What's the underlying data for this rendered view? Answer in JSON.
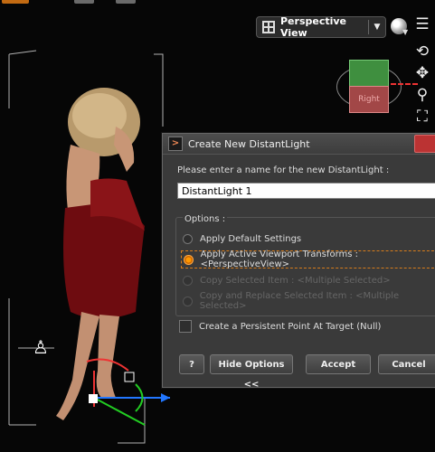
{
  "viewport": {
    "view_selector": {
      "label": "Perspective View",
      "icon": "grid-view-icon",
      "dropdown_icon": "triangle-down-icon"
    },
    "nav_cube": {
      "face_label": "Right",
      "top_color": "#3f8f3f",
      "front_color": "#a24747"
    },
    "side_icons": [
      "menu-list-icon",
      "orbit-icon",
      "pan-move-icon",
      "zoom-icon",
      "frame-icon"
    ]
  },
  "dialog": {
    "title": "Create New DistantLight",
    "prompt": "Please enter a name for the new DistantLight :",
    "name_value": "DistantLight 1",
    "options_label": "Options :",
    "options": [
      {
        "label": "Apply Default Settings",
        "selected": false,
        "enabled": true
      },
      {
        "label": "Apply Active Viewport Transforms : <PerspectiveView>",
        "selected": true,
        "enabled": true
      },
      {
        "label": "Copy Selected Item : <Multiple Selected>",
        "selected": false,
        "enabled": false
      },
      {
        "label": "Copy and Replace Selected Item : <Multiple Selected>",
        "selected": false,
        "enabled": false
      }
    ],
    "checkbox_label": "Create a Persistent Point At Target (Null)",
    "buttons": {
      "help": "?",
      "hide_options": "Hide Options <<",
      "accept": "Accept",
      "cancel": "Cancel"
    }
  },
  "colors": {
    "accent": "#d77c1b",
    "dialog_bg": "#3a3a3a",
    "close_red": "#b33333"
  }
}
